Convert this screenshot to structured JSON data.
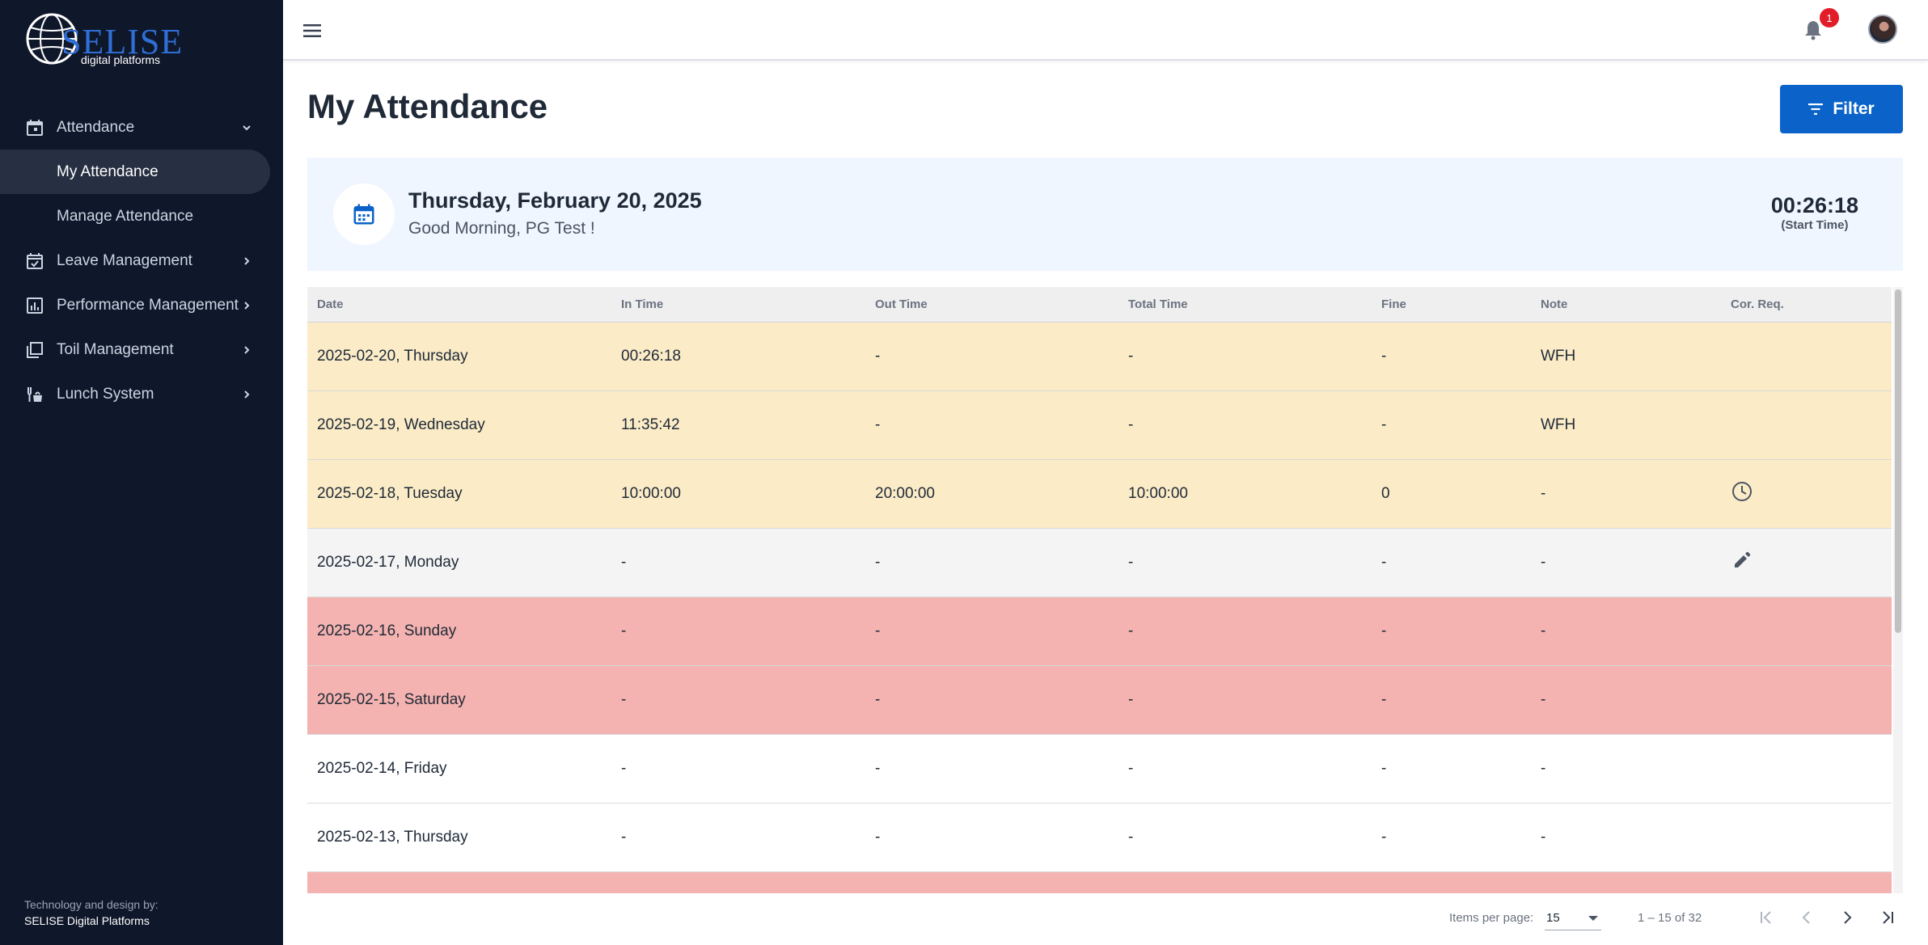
{
  "logo": {
    "brand": "SELISE",
    "sub": "digital platforms"
  },
  "sidebar": {
    "items": [
      {
        "label": "Attendance",
        "icon": "calendar-icon",
        "chevron": "chevron-down-icon"
      },
      {
        "label": "My Attendance"
      },
      {
        "label": "Manage Attendance"
      },
      {
        "label": "Leave Management",
        "icon": "calendar-check-icon",
        "chevron": "chevron-right-icon"
      },
      {
        "label": "Performance Management",
        "icon": "bar-chart-icon",
        "chevron": "chevron-right-icon"
      },
      {
        "label": "Toil Management",
        "icon": "copy-icon",
        "chevron": "chevron-right-icon"
      },
      {
        "label": "Lunch System",
        "icon": "food-icon",
        "chevron": "chevron-right-icon"
      }
    ],
    "credits_line1": "Technology and design by:",
    "credits_line2": "SELISE Digital Platforms"
  },
  "topbar": {
    "notification_count": "1"
  },
  "main": {
    "title": "My Attendance",
    "filter_label": "Filter",
    "date": "Thursday, February 20, 2025",
    "greeting": "Good Morning, PG Test !",
    "start_time": "00:26:18",
    "start_time_label": "(Start Time)"
  },
  "table": {
    "headers": [
      "Date",
      "In Time",
      "Out Time",
      "Total Time",
      "Fine",
      "Note",
      "Cor. Req."
    ],
    "rows": [
      {
        "date": "2025-02-20, Thursday",
        "in": "00:26:18",
        "out": "-",
        "total": "-",
        "fine": "-",
        "note": "WFH",
        "status": "yellow"
      },
      {
        "date": "2025-02-19, Wednesday",
        "in": "11:35:42",
        "out": "-",
        "total": "-",
        "fine": "-",
        "note": "WFH",
        "status": "yellow"
      },
      {
        "date": "2025-02-18, Tuesday",
        "in": "10:00:00",
        "out": "20:00:00",
        "total": "10:00:00",
        "fine": "0",
        "note": "-",
        "status": "yellow",
        "action": "clock-icon"
      },
      {
        "date": "2025-02-17, Monday",
        "in": "-",
        "out": "-",
        "total": "-",
        "fine": "-",
        "note": "-",
        "status": "gray",
        "action": "pencil-icon"
      },
      {
        "date": "2025-02-16, Sunday",
        "in": "-",
        "out": "-",
        "total": "-",
        "fine": "-",
        "note": "-",
        "status": "red"
      },
      {
        "date": "2025-02-15, Saturday",
        "in": "-",
        "out": "-",
        "total": "-",
        "fine": "-",
        "note": "-",
        "status": "red"
      },
      {
        "date": "2025-02-14, Friday",
        "in": "-",
        "out": "-",
        "total": "-",
        "fine": "-",
        "note": "-",
        "status": "white"
      },
      {
        "date": "2025-02-13, Thursday",
        "in": "-",
        "out": "-",
        "total": "-",
        "fine": "-",
        "note": "-",
        "status": "white"
      },
      {
        "date": "",
        "in": "",
        "out": "",
        "total": "",
        "fine": "",
        "note": "",
        "status": "red"
      }
    ]
  },
  "paginator": {
    "items_per_page_label": "Items per page:",
    "items_per_page": "15",
    "range": "1 – 15 of 32"
  },
  "colors": {
    "sidebar_bg": "#0f172a",
    "accent": "#0b63c9",
    "row_yellow": "#fbecc7",
    "row_red": "#f4b3b0",
    "row_gray": "#f4f4f4",
    "badge": "#e11d2a"
  }
}
